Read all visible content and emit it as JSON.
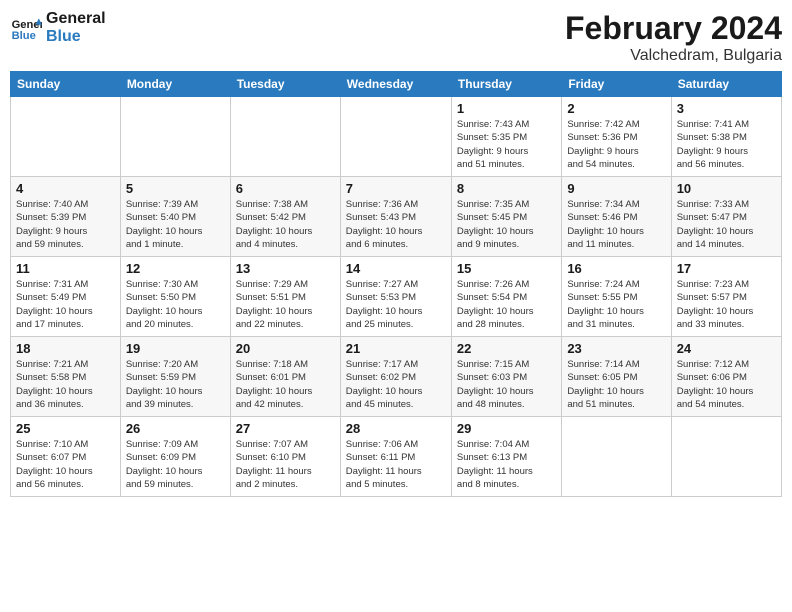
{
  "header": {
    "logo_line1": "General",
    "logo_line2": "Blue",
    "month": "February 2024",
    "location": "Valchedram, Bulgaria"
  },
  "weekdays": [
    "Sunday",
    "Monday",
    "Tuesday",
    "Wednesday",
    "Thursday",
    "Friday",
    "Saturday"
  ],
  "weeks": [
    [
      {
        "day": "",
        "info": ""
      },
      {
        "day": "",
        "info": ""
      },
      {
        "day": "",
        "info": ""
      },
      {
        "day": "",
        "info": ""
      },
      {
        "day": "1",
        "info": "Sunrise: 7:43 AM\nSunset: 5:35 PM\nDaylight: 9 hours\nand 51 minutes."
      },
      {
        "day": "2",
        "info": "Sunrise: 7:42 AM\nSunset: 5:36 PM\nDaylight: 9 hours\nand 54 minutes."
      },
      {
        "day": "3",
        "info": "Sunrise: 7:41 AM\nSunset: 5:38 PM\nDaylight: 9 hours\nand 56 minutes."
      }
    ],
    [
      {
        "day": "4",
        "info": "Sunrise: 7:40 AM\nSunset: 5:39 PM\nDaylight: 9 hours\nand 59 minutes."
      },
      {
        "day": "5",
        "info": "Sunrise: 7:39 AM\nSunset: 5:40 PM\nDaylight: 10 hours\nand 1 minute."
      },
      {
        "day": "6",
        "info": "Sunrise: 7:38 AM\nSunset: 5:42 PM\nDaylight: 10 hours\nand 4 minutes."
      },
      {
        "day": "7",
        "info": "Sunrise: 7:36 AM\nSunset: 5:43 PM\nDaylight: 10 hours\nand 6 minutes."
      },
      {
        "day": "8",
        "info": "Sunrise: 7:35 AM\nSunset: 5:45 PM\nDaylight: 10 hours\nand 9 minutes."
      },
      {
        "day": "9",
        "info": "Sunrise: 7:34 AM\nSunset: 5:46 PM\nDaylight: 10 hours\nand 11 minutes."
      },
      {
        "day": "10",
        "info": "Sunrise: 7:33 AM\nSunset: 5:47 PM\nDaylight: 10 hours\nand 14 minutes."
      }
    ],
    [
      {
        "day": "11",
        "info": "Sunrise: 7:31 AM\nSunset: 5:49 PM\nDaylight: 10 hours\nand 17 minutes."
      },
      {
        "day": "12",
        "info": "Sunrise: 7:30 AM\nSunset: 5:50 PM\nDaylight: 10 hours\nand 20 minutes."
      },
      {
        "day": "13",
        "info": "Sunrise: 7:29 AM\nSunset: 5:51 PM\nDaylight: 10 hours\nand 22 minutes."
      },
      {
        "day": "14",
        "info": "Sunrise: 7:27 AM\nSunset: 5:53 PM\nDaylight: 10 hours\nand 25 minutes."
      },
      {
        "day": "15",
        "info": "Sunrise: 7:26 AM\nSunset: 5:54 PM\nDaylight: 10 hours\nand 28 minutes."
      },
      {
        "day": "16",
        "info": "Sunrise: 7:24 AM\nSunset: 5:55 PM\nDaylight: 10 hours\nand 31 minutes."
      },
      {
        "day": "17",
        "info": "Sunrise: 7:23 AM\nSunset: 5:57 PM\nDaylight: 10 hours\nand 33 minutes."
      }
    ],
    [
      {
        "day": "18",
        "info": "Sunrise: 7:21 AM\nSunset: 5:58 PM\nDaylight: 10 hours\nand 36 minutes."
      },
      {
        "day": "19",
        "info": "Sunrise: 7:20 AM\nSunset: 5:59 PM\nDaylight: 10 hours\nand 39 minutes."
      },
      {
        "day": "20",
        "info": "Sunrise: 7:18 AM\nSunset: 6:01 PM\nDaylight: 10 hours\nand 42 minutes."
      },
      {
        "day": "21",
        "info": "Sunrise: 7:17 AM\nSunset: 6:02 PM\nDaylight: 10 hours\nand 45 minutes."
      },
      {
        "day": "22",
        "info": "Sunrise: 7:15 AM\nSunset: 6:03 PM\nDaylight: 10 hours\nand 48 minutes."
      },
      {
        "day": "23",
        "info": "Sunrise: 7:14 AM\nSunset: 6:05 PM\nDaylight: 10 hours\nand 51 minutes."
      },
      {
        "day": "24",
        "info": "Sunrise: 7:12 AM\nSunset: 6:06 PM\nDaylight: 10 hours\nand 54 minutes."
      }
    ],
    [
      {
        "day": "25",
        "info": "Sunrise: 7:10 AM\nSunset: 6:07 PM\nDaylight: 10 hours\nand 56 minutes."
      },
      {
        "day": "26",
        "info": "Sunrise: 7:09 AM\nSunset: 6:09 PM\nDaylight: 10 hours\nand 59 minutes."
      },
      {
        "day": "27",
        "info": "Sunrise: 7:07 AM\nSunset: 6:10 PM\nDaylight: 11 hours\nand 2 minutes."
      },
      {
        "day": "28",
        "info": "Sunrise: 7:06 AM\nSunset: 6:11 PM\nDaylight: 11 hours\nand 5 minutes."
      },
      {
        "day": "29",
        "info": "Sunrise: 7:04 AM\nSunset: 6:13 PM\nDaylight: 11 hours\nand 8 minutes."
      },
      {
        "day": "",
        "info": ""
      },
      {
        "day": "",
        "info": ""
      }
    ]
  ]
}
